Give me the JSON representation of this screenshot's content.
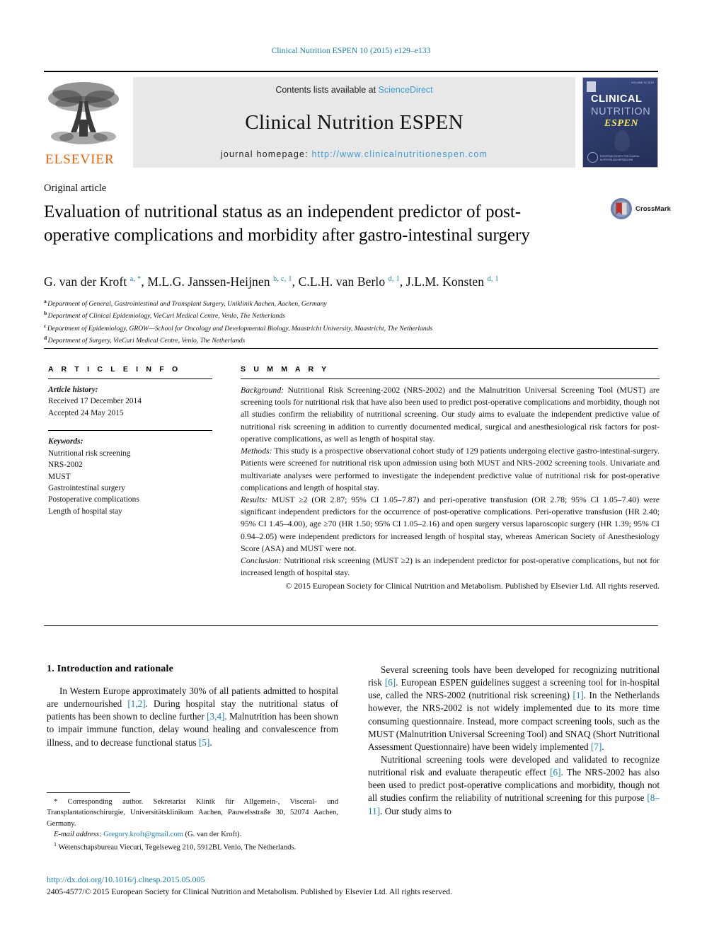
{
  "running_head": "Clinical Nutrition ESPEN 10 (2015) e129–e133",
  "masthead": {
    "publisher_name": "ELSEVIER",
    "contents_prefix": "Contents lists available at ",
    "contents_link": "ScienceDirect",
    "journal_name": "Clinical Nutrition ESPEN",
    "homepage_label": "journal homepage: ",
    "homepage_url": "http://www.clinicalnutritionespen.com",
    "cover": {
      "line1": "CLINICAL",
      "line2": "NUTRITION",
      "line3": "ESPEN",
      "issue_tag": "VOLUME 10 2015",
      "society": "EUROPEAN SOCIETY FOR CLINICAL NUTRITION AND METABOLISM"
    },
    "link_color": "#3e9bd1"
  },
  "article": {
    "type": "Original article",
    "title": "Evaluation of nutritional status as an independent predictor of post-operative complications and morbidity after gastro-intestinal surgery",
    "crossmark_label": "CrossMark",
    "authors_html": "G. van der Kroft <sup>a, *</sup>, M.L.G. Janssen-Heijnen <sup>b, c, 1</sup>, C.L.H. van Berlo <sup>d, 1</sup>, J.L.M. Konsten <sup>d, 1</sup>",
    "affiliations": [
      {
        "mark": "a",
        "text": "Department of General, Gastrointestinal and Transplant Surgery, Uniklinik Aachen, Aachen, Germany"
      },
      {
        "mark": "b",
        "text": "Department of Clinical Epidemiology, VieCuri Medical Centre, Venlo, The Netherlands"
      },
      {
        "mark": "c",
        "text": "Department of Epidemiology, GROW—School for Oncology and Developmental Biology, Maastricht University, Maastricht, The Netherlands"
      },
      {
        "mark": "d",
        "text": "Department of Surgery, VieCuri Medical Centre, Venlo, The Netherlands"
      }
    ]
  },
  "info": {
    "heading": "A R T I C L E  I N F O",
    "history_label": "Article history:",
    "history": [
      "Received 17 December 2014",
      "Accepted 24 May 2015"
    ],
    "keywords_label": "Keywords:",
    "keywords": [
      "Nutritional risk screening",
      "NRS-2002",
      "MUST",
      "Gastrointestinal surgery",
      "Postoperative complications",
      "Length of hospital stay"
    ]
  },
  "summary": {
    "heading": "S U M M A R Y",
    "background_label": "Background:",
    "background": " Nutritional Risk Screening-2002 (NRS-2002) and the Malnutrition Universal Screening Tool (MUST) are screening tools for nutritional risk that have also been used to predict post-operative complications and morbidity, though not all studies confirm the reliability of nutritional screening. Our study aims to evaluate the independent predictive value of nutritional risk screening in addition to currently documented medical, surgical and anesthesiological risk factors for post-operative complications, as well as length of hospital stay.",
    "methods_label": "Methods:",
    "methods": " This study is a prospective observational cohort study of 129 patients undergoing elective gastro-intestinal-surgery. Patients were screened for nutritional risk upon admission using both MUST and NRS-2002 screening tools. Univariate and multivariate analyses were performed to investigate the independent predictive value of nutritional risk for post-operative complications and length of hospital stay.",
    "results_label": "Results:",
    "results": " MUST ≥2 (OR 2.87; 95% CI 1.05–7.87) and peri-operative transfusion (OR 2.78; 95% CI 1.05–7.40) were significant independent predictors for the occurrence of post-operative complications. Peri-operative transfusion (HR 2.40; 95% CI 1.45–4.00), age ≥70 (HR 1.50; 95% CI 1.05–2.16) and open surgery versus laparoscopic surgery (HR 1.39; 95% CI 0.94–2.05) were independent predictors for increased length of hospital stay, whereas American Society of Anesthesiology Score (ASA) and MUST were not.",
    "conclusion_label": "Conclusion:",
    "conclusion": " Nutritional risk screening (MUST ≥2) is an independent predictor for post-operative complications, but not for increased length of hospital stay.",
    "copyright": "© 2015 European Society for Clinical Nutrition and Metabolism. Published by Elsevier Ltd. All rights reserved."
  },
  "body": {
    "section_heading": "1. Introduction and rationale",
    "left_paragraph_parts": [
      "In Western Europe approximately 30% of all patients admitted to hospital are undernourished ",
      "[1,2]",
      ". During hospital stay the nutritional status of patients has been shown to decline further ",
      "[3,4]",
      ". Malnutrition has been shown to impair immune function, delay wound healing and convalescence from illness, and to decrease functional status ",
      "[5]",
      "."
    ],
    "right_paragraph1_parts": [
      "Several screening tools have been developed for recognizing nutritional risk ",
      "[6]",
      ". European ESPEN guidelines suggest a screening tool for in-hospital use, called the NRS-2002 (nutritional risk screening) ",
      "[1]",
      ". In the Netherlands however, the NRS-2002 is not widely implemented due to its more time consuming questionnaire. Instead, more compact screening tools, such as the MUST (Malnutrition Universal Screening Tool) and SNAQ (Short Nutritional Assessment Questionnaire) have been widely implemented ",
      "[7]",
      "."
    ],
    "right_paragraph2_parts": [
      "Nutritional screening tools were developed and validated to recognize nutritional risk and evaluate therapeutic effect ",
      "[6]",
      ". The NRS-2002 has also been used to predict post-operative complications and morbidity, though not all studies confirm the reliability of nutritional screening for this purpose ",
      "[8–11]",
      ". Our study aims to"
    ]
  },
  "footnotes": {
    "corresponding": "* Corresponding author. Sekretariat Klinik für Allgemein-, Visceral- und Transplantationschirurgie, Universitätsklinikum Aachen, Pauwelsstraße 30, 52074 Aachen, Germany.",
    "email_label": "E-mail address:",
    "email": "Gregory.kroft@gmail.com",
    "email_suffix": " (G. van der Kroft).",
    "note1_mark": "1",
    "note1": " Wetenschapsbureau Viecuri, Tegelseweg 210, 5912BL Venlo, The Netherlands."
  },
  "footer": {
    "doi": "http://dx.doi.org/10.1016/j.clnesp.2015.05.005",
    "issn": "2405-4577/© 2015 European Society for Clinical Nutrition and Metabolism. Published by Elsevier Ltd. All rights reserved."
  },
  "colors": {
    "link": "#1a7fae",
    "masthead_link": "#3e9bd1",
    "elsevier_orange": "#E8610A"
  }
}
